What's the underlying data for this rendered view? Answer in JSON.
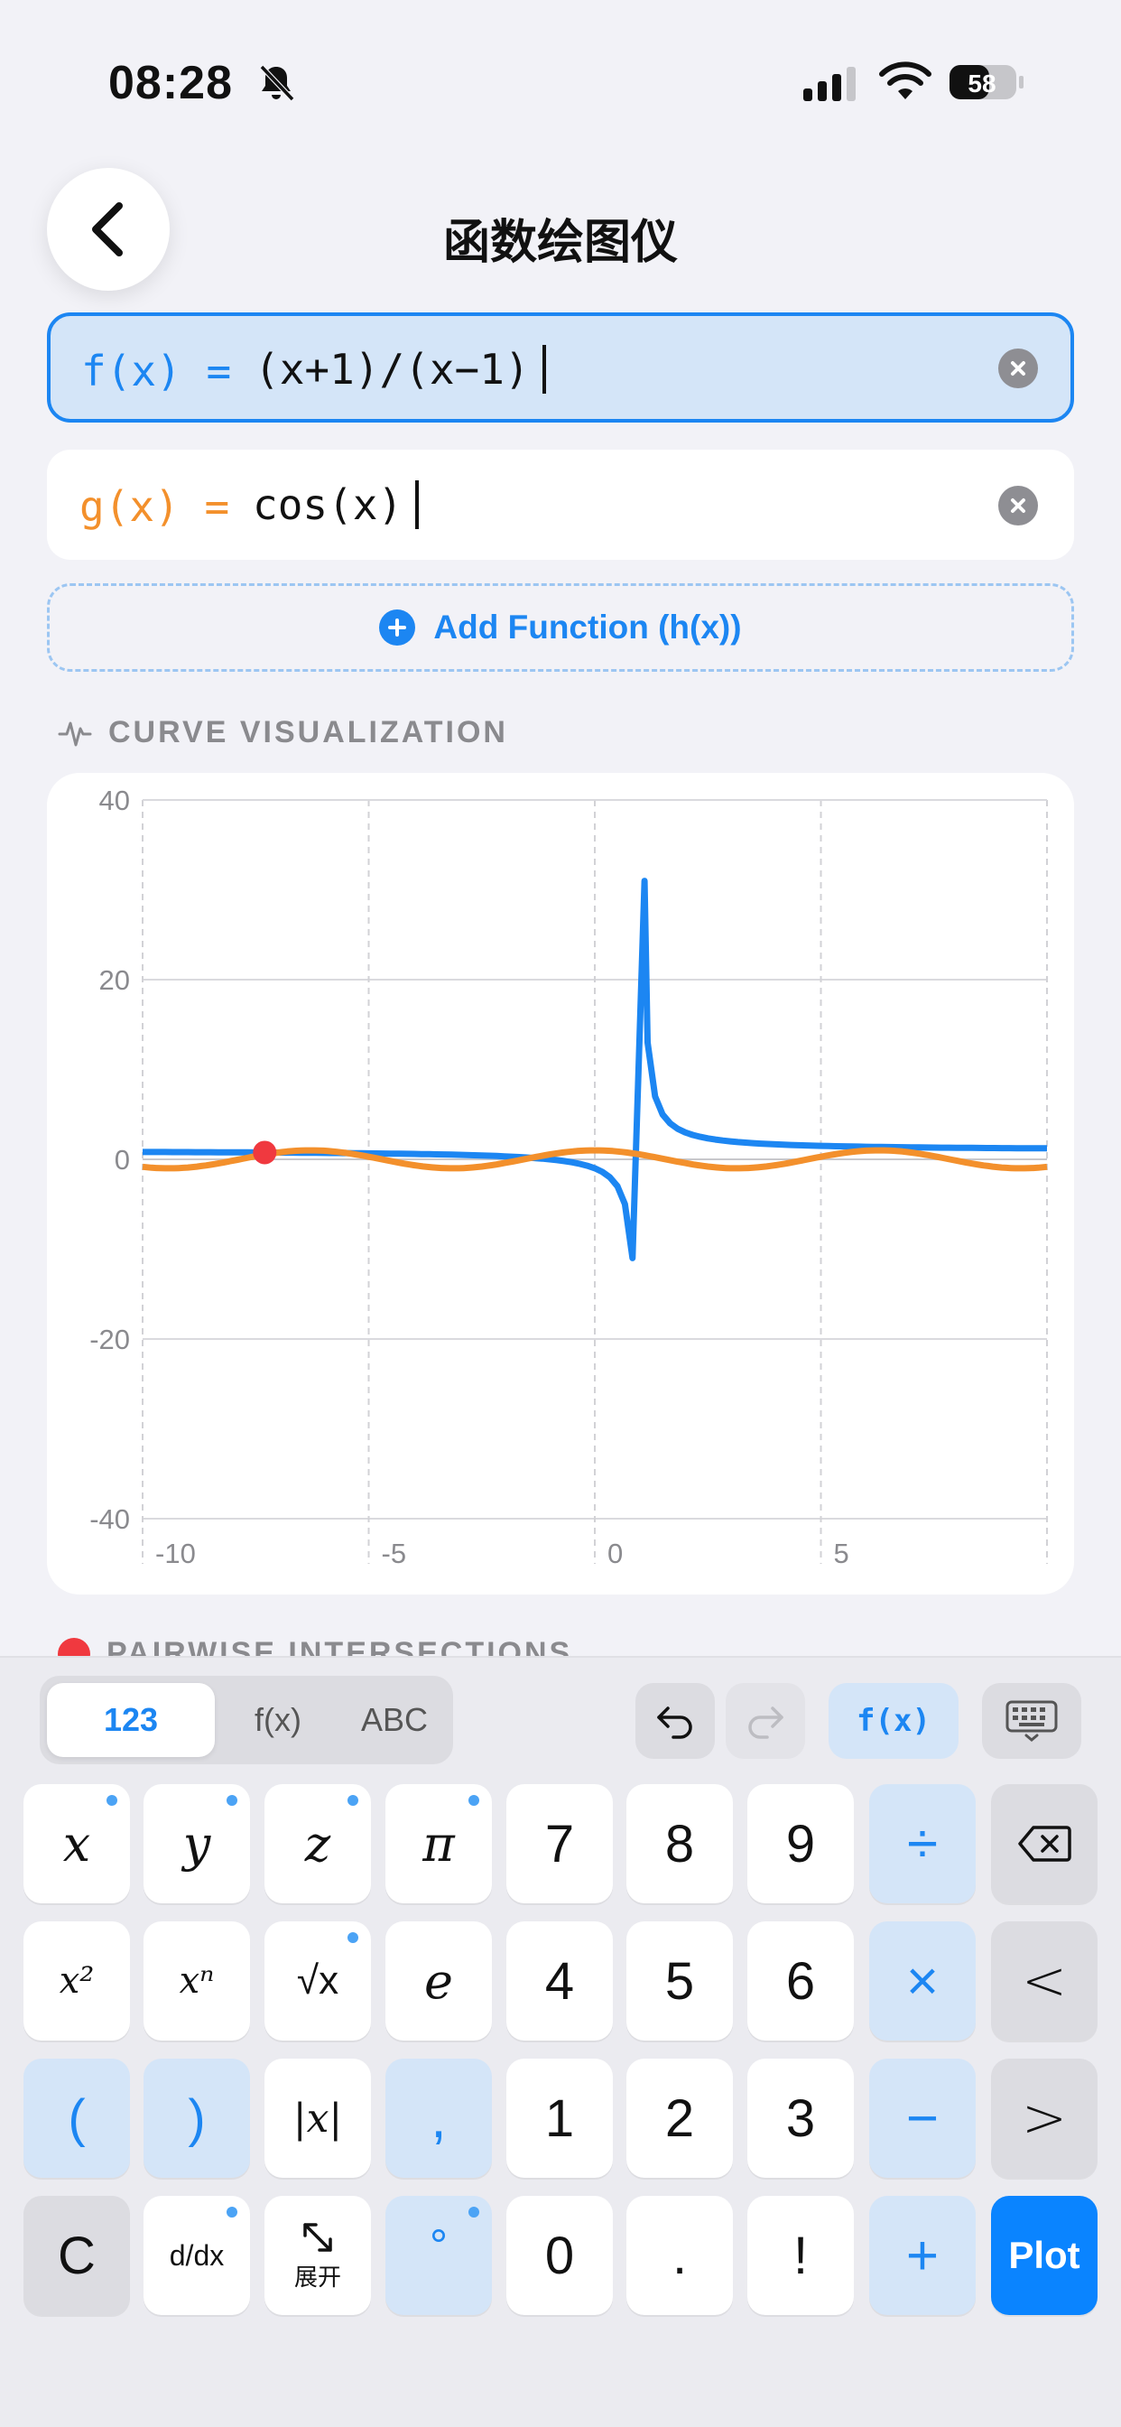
{
  "status": {
    "time": "08:28",
    "battery": "58"
  },
  "nav": {
    "title": "函数绘图仪"
  },
  "functions": [
    {
      "name": "f(x) =",
      "expr": "(x+1)/(x−1)",
      "color": "#1C86F2"
    },
    {
      "name": "g(x) =",
      "expr": "cos(x)",
      "color": "#F3902C"
    }
  ],
  "add_function": {
    "label": "Add Function (h(x))"
  },
  "sections": {
    "curve": "CURVE VISUALIZATION",
    "intersections": "PAIRWISE INTERSECTIONS"
  },
  "chart_data": {
    "type": "line",
    "xlim": [
      -10,
      10
    ],
    "ylim": [
      -40,
      40
    ],
    "x_ticks": [
      -10,
      -5,
      0,
      5
    ],
    "y_ticks": [
      40,
      20,
      0,
      -20,
      -40
    ],
    "grid": true,
    "series": [
      {
        "expr": "(x+1)/(x−1)",
        "color": "#1C86F2"
      },
      {
        "expr": "cos(x)",
        "color": "#F3902C"
      }
    ],
    "intersection_point": {
      "x": -7.3,
      "y": 0.76,
      "color": "#F0393F"
    }
  },
  "keyboard": {
    "modes": [
      "123",
      "f(x)",
      "ABC"
    ],
    "fx_button": "f(x)",
    "rows": [
      [
        "x",
        "y",
        "z",
        "π",
        "7",
        "8",
        "9",
        "÷",
        "⌫"
      ],
      [
        "x²",
        "xⁿ",
        "√x",
        "e",
        "4",
        "5",
        "6",
        "×",
        "<"
      ],
      [
        "(",
        ")",
        "|x|",
        ",",
        "1",
        "2",
        "3",
        "−",
        ">"
      ],
      [
        "C",
        "d/dx",
        "展开",
        "°",
        "0",
        ".",
        "!",
        "+",
        "Plot"
      ]
    ]
  }
}
